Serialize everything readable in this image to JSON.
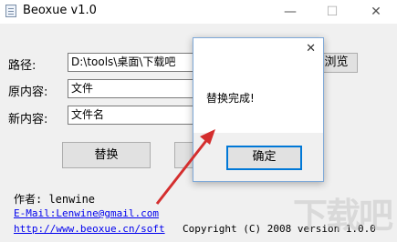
{
  "window": {
    "title": "Beoxue v1.0",
    "controls": {
      "minimize": "—",
      "maximize": "☐",
      "close": "✕"
    }
  },
  "form": {
    "path_label": "路径:",
    "path_value": "D:\\tools\\桌面\\下载吧",
    "browse_label": "浏览",
    "original_label": "原内容:",
    "original_value": "文件",
    "new_label": "新内容:",
    "new_value": "文件名",
    "replace_button": "替换"
  },
  "footer": {
    "author": "作者: lenwine",
    "email": "E-Mail:Lenwine@gmail.com",
    "website": "http://www.beoxue.cn/soft",
    "copyright": "Copyright (C) 2008 version 1.0.0"
  },
  "dialog": {
    "close": "✕",
    "message": "替换完成!",
    "ok_label": "确定"
  },
  "colors": {
    "arrow": "#d42e2e",
    "focus_border": "#0078d7"
  },
  "watermark": "下载吧"
}
